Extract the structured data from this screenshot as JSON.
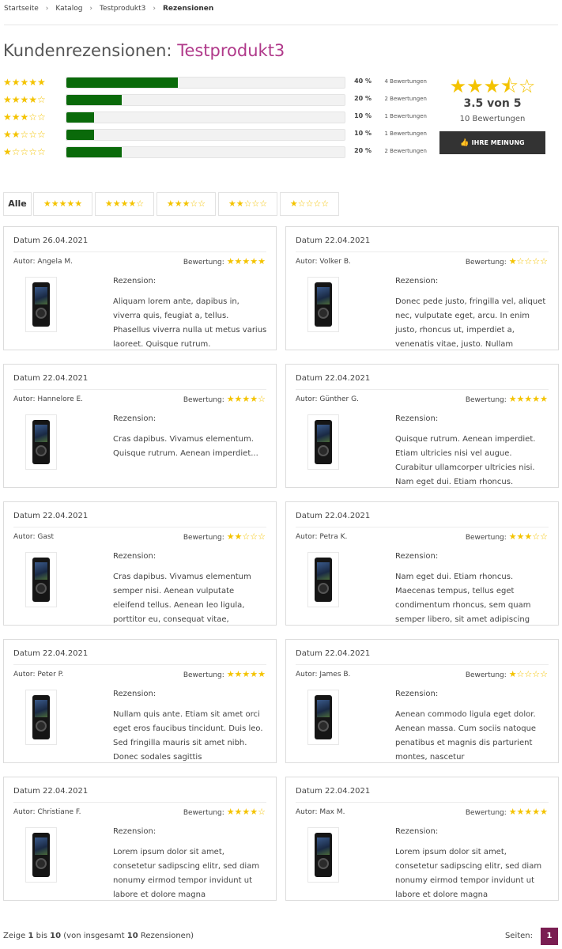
{
  "breadcrumb": [
    "Startseite",
    "Katalog",
    "Testprodukt3",
    "Rezensionen"
  ],
  "title": {
    "prefix": "Kundenrezensionen:",
    "product": "Testprodukt3"
  },
  "distribution": [
    {
      "stars": "★★★★★",
      "percent_label": "40 %",
      "count_label": "4 Bewertungen",
      "fraction": 0.4
    },
    {
      "stars": "★★★★☆",
      "percent_label": "20 %",
      "count_label": "2 Bewertungen",
      "fraction": 0.2
    },
    {
      "stars": "★★★☆☆",
      "percent_label": "10 %",
      "count_label": "1 Bewertungen",
      "fraction": 0.1
    },
    {
      "stars": "★★☆☆☆",
      "percent_label": "10 %",
      "count_label": "1 Bewertungen",
      "fraction": 0.1
    },
    {
      "stars": "★☆☆☆☆",
      "percent_label": "20 %",
      "count_label": "2 Bewertungen",
      "fraction": 0.2
    }
  ],
  "summary": {
    "stars": "★★★⯪☆",
    "average": "3.5 von 5",
    "total": "10 Bewertungen",
    "button": "IHRE MEINUNG",
    "button_icon": "thumbs-up-icon"
  },
  "filters": {
    "all": "Alle",
    "stars": [
      "★★★★★",
      "★★★★☆",
      "★★★☆☆",
      "★★☆☆☆",
      "★☆☆☆☆"
    ]
  },
  "labels": {
    "date": "Datum",
    "author": "Autor:",
    "rating": "Bewertung:",
    "review": "Rezension:"
  },
  "reviews": [
    {
      "date": "26.04.2021",
      "author": "Angela M.",
      "stars": "★★★★★",
      "text": "Aliquam lorem ante, dapibus in, viverra quis, feugiat a, tellus. Phasellus viverra nulla ut metus varius laoreet. Quisque rutrum."
    },
    {
      "date": "22.04.2021",
      "author": "Volker B.",
      "stars": "★☆☆☆☆",
      "text": "Donec pede justo, fringilla vel, aliquet nec, vulputate eget, arcu. In enim justo, rhoncus ut, imperdiet a, venenatis vitae, justo. Nullam"
    },
    {
      "date": "22.04.2021",
      "author": "Hannelore E.",
      "stars": "★★★★☆",
      "text": "Cras dapibus. Vivamus elementum. Quisque rutrum. Aenean imperdiet..."
    },
    {
      "date": "22.04.2021",
      "author": "Günther G.",
      "stars": "★★★★★",
      "text": "Quisque rutrum. Aenean imperdiet. Etiam ultricies nisi vel augue. Curabitur ullamcorper ultricies nisi. Nam eget dui. Etiam rhoncus."
    },
    {
      "date": "22.04.2021",
      "author": "Gast",
      "stars": "★★☆☆☆",
      "text": "Cras dapibus. Vivamus elementum semper nisi. Aenean vulputate eleifend tellus. Aenean leo ligula, porttitor eu, consequat vitae,"
    },
    {
      "date": "22.04.2021",
      "author": "Petra K.",
      "stars": "★★★☆☆",
      "text": "Nam eget dui. Etiam rhoncus. Maecenas tempus, tellus eget condimentum rhoncus, sem quam semper libero, sit amet adipiscing"
    },
    {
      "date": "22.04.2021",
      "author": "Peter P.",
      "stars": "★★★★★",
      "text": "Nullam quis ante. Etiam sit amet orci eget eros faucibus tincidunt. Duis leo. Sed fringilla mauris sit amet nibh. Donec sodales sagittis"
    },
    {
      "date": "22.04.2021",
      "author": "James B.",
      "stars": "★☆☆☆☆",
      "text": "Aenean commodo ligula eget dolor. Aenean massa. Cum sociis natoque penatibus et magnis dis parturient montes, nascetur"
    },
    {
      "date": "22.04.2021",
      "author": "Christiane F.",
      "stars": "★★★★☆",
      "text": "Lorem ipsum dolor sit amet, consetetur sadipscing elitr, sed diam nonumy eirmod tempor invidunt ut labore et dolore magna"
    },
    {
      "date": "22.04.2021",
      "author": "Max M.",
      "stars": "★★★★★",
      "text": "Lorem ipsum dolor sit amet, consetetur sadipscing elitr, sed diam nonumy eirmod tempor invidunt ut labore et dolore magna"
    }
  ],
  "footer": {
    "prefix": "Zeige",
    "from": "1",
    "mid": "bis",
    "to": "10",
    "rest": "(von insgesamt",
    "total": "10",
    "suffix": "Rezensionen)",
    "pages_label": "Seiten:",
    "current_page": "1"
  },
  "colors": {
    "accent": "#b0398a",
    "bar": "#0a6a0a",
    "star": "#f4c300",
    "page_active": "#7a1e52"
  }
}
